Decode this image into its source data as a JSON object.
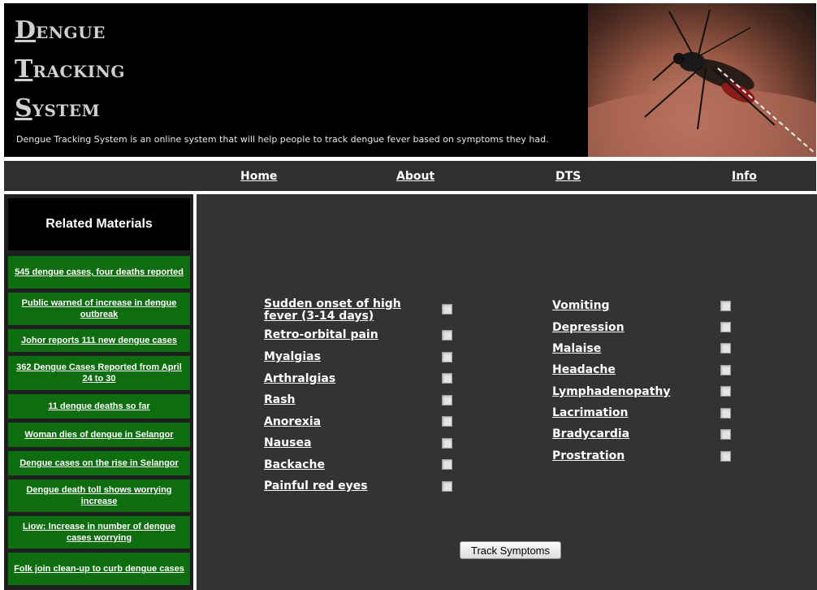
{
  "header": {
    "logo_lines": [
      {
        "initial": "D",
        "rest": "ENGUE"
      },
      {
        "initial": "T",
        "rest": "RACKING"
      },
      {
        "initial": "S",
        "rest": "YSTEM"
      }
    ],
    "tagline": "Dengue Tracking System is an online system that will help people to track dengue fever based on symptoms they had."
  },
  "nav": {
    "items": [
      "Home",
      "About",
      "DTS",
      "Info"
    ]
  },
  "sidebar": {
    "title": "Related Materials",
    "items": [
      "545 dengue cases, four deaths reported",
      "Public warned of increase in dengue outbreak",
      "Johor reports 111 new dengue cases",
      "362 Dengue Cases Reported from April 24 to 30",
      "11 dengue deaths so far",
      "Woman dies of dengue in Selangor",
      "Dengue cases on the rise in Selangor",
      "Dengue death toll shows worrying increase",
      "Liow: Increase in number of dengue cases worrying",
      "Folk join clean-up to curb dengue cases"
    ]
  },
  "symptoms": {
    "left": [
      "Sudden onset of high fever (3-14 days)",
      "Retro-orbital pain",
      "Myalgias",
      "Arthralgias",
      "Rash",
      "Anorexia",
      "Nausea",
      "Backache",
      "Painful red eyes"
    ],
    "right": [
      "Vomiting",
      "Depression",
      "Malaise",
      "Headache",
      "Lymphadenopathy",
      "Lacrimation",
      "Bradycardia",
      "Prostration"
    ]
  },
  "actions": {
    "track_label": "Track Symptoms"
  },
  "colors": {
    "header_bg": "#000000",
    "nav_bg": "#2f2f2f",
    "main_bg": "#333333",
    "sidebar_item_bg": "#0e6d0e"
  },
  "icons": {
    "header_image": "mosquito-photo"
  }
}
